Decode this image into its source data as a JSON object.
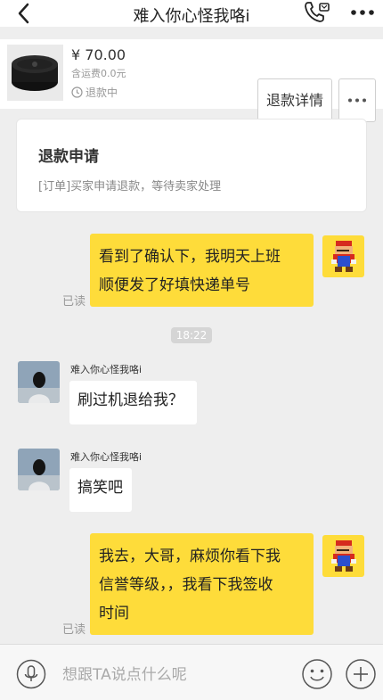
{
  "header": {
    "title": "难入你心怪我咯i"
  },
  "product": {
    "price": "¥ 70.00",
    "shipping": "含运费0.0元",
    "status": "退款中",
    "detail_button": "退款详情"
  },
  "refund_card": {
    "title": "退款申请",
    "description": "[订单]买家申请退款，等待卖家处理"
  },
  "messages": [
    {
      "direction": "out",
      "text_line1": "看到了确认下，我明天上班",
      "text_line2": "顺便发了好填快递单号",
      "read": "已读"
    },
    {
      "type": "time",
      "text": "18:22"
    },
    {
      "direction": "in",
      "sender": "难入你心怪我咯i",
      "text": "刷过机退给我？"
    },
    {
      "direction": "in",
      "sender": "难入你心怪我咯i",
      "text": "搞笑吧"
    },
    {
      "direction": "out",
      "text_line1": "我去，大哥，麻烦你看下我",
      "text_line2": "信誉等级，，我看下我签收",
      "text_line3": "时间",
      "read": "已读"
    }
  ],
  "input": {
    "placeholder": "想跟TA说点什么呢"
  },
  "colors": {
    "bubble_out": "#fedc3a",
    "bubble_in": "#ffffff",
    "background": "#eeeeee"
  },
  "icons": {
    "back": "chevron-left-icon",
    "call": "phone-icon",
    "more": "more-horizontal-icon",
    "clock": "clock-icon",
    "mic": "microphone-icon",
    "emoji": "smiley-icon",
    "plus": "plus-circle-icon"
  }
}
